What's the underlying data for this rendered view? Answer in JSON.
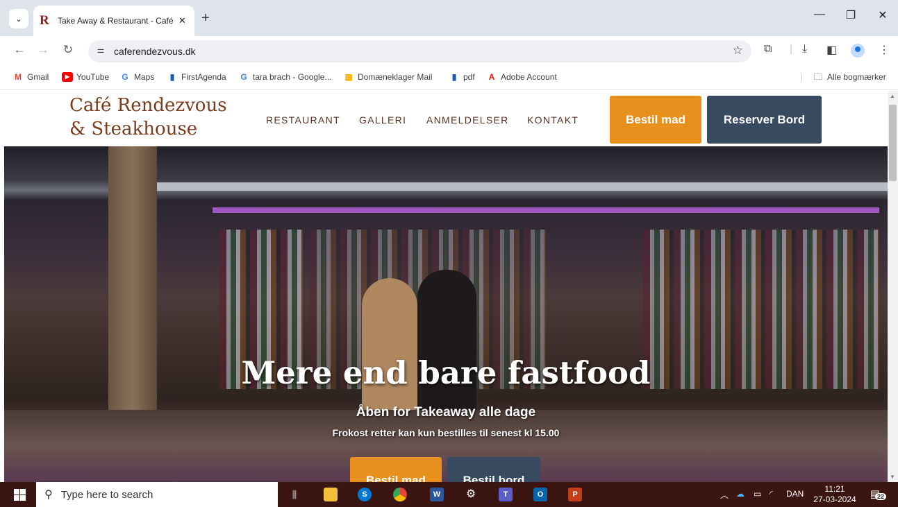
{
  "browser": {
    "tab": {
      "favicon": "R",
      "title": "Take Away & Restaurant - Café",
      "close": "✕"
    },
    "new_tab": "+",
    "window_controls": {
      "minimize": "—",
      "restore": "❐",
      "close": "✕"
    },
    "url": "caferendezvous.dk",
    "bookmarks": [
      {
        "label": "Gmail",
        "icon": "M",
        "color": "#ea4335"
      },
      {
        "label": "YouTube",
        "icon": "▶",
        "color": "#ff0000"
      },
      {
        "label": "Maps",
        "icon": "G",
        "color": "#4285f4"
      },
      {
        "label": "FirstAgenda",
        "icon": "▮",
        "color": "#1a56b5"
      },
      {
        "label": "tara brach - Google...",
        "icon": "G",
        "color": "#4285f4"
      },
      {
        "label": "Domæneklager Mail",
        "icon": "▦",
        "color": "#f4b400"
      },
      {
        "label": "pdf",
        "icon": "▮",
        "color": "#1a56b5"
      },
      {
        "label": "Adobe Account",
        "icon": "A",
        "color": "#fa0f00"
      }
    ],
    "all_bookmarks": "Alle bogmærker"
  },
  "site": {
    "logo_line1": "Café Rendezvous",
    "logo_line2": "& Steakhouse",
    "nav": [
      "RESTAURANT",
      "GALLERI",
      "ANMELDELSER",
      "KONTAKT"
    ],
    "order_button": "Bestil mad",
    "reserve_button": "Reserver Bord",
    "accent_color": "#e8901e",
    "dark_color": "#374a60",
    "hero": {
      "title": "Mere end bare fastfood",
      "subtitle": "Åben for Takeaway alle dage",
      "note": "Frokost retter kan kun bestilles til senest kl 15.00",
      "button_order": "Bestil mad",
      "button_table": "Bestil bord"
    }
  },
  "taskbar": {
    "search_placeholder": "Type here to search",
    "language": "DAN",
    "time": "11:21",
    "date": "27-03-2024",
    "notifications": "22"
  }
}
